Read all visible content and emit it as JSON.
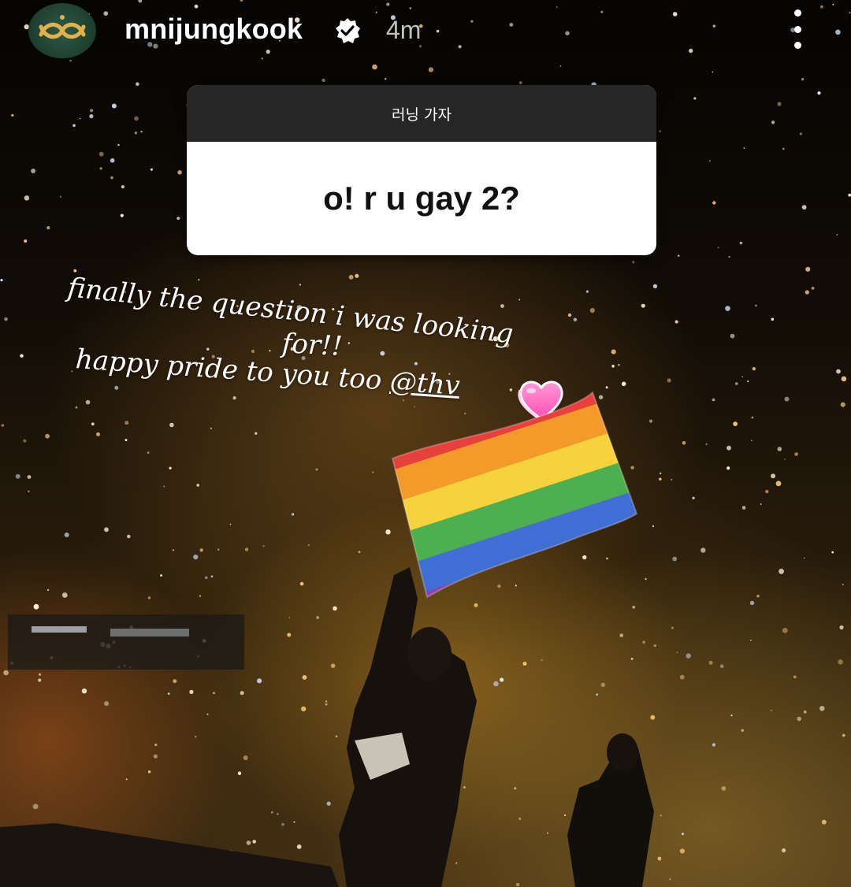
{
  "story": {
    "username": "mnijungkook",
    "timestamp": "4m",
    "verified": true,
    "icons": {
      "avatar": "avatar-logo-icon",
      "verified": "verified-badge-icon",
      "more": "more-options-icon"
    }
  },
  "question_sticker": {
    "prompt": "러닝 가자",
    "answer": "o! r u gay 2?"
  },
  "caption": {
    "line1": "finally the question i was looking",
    "line2": "for!!",
    "line3_prefix": "happy pride to you too ",
    "mention": "@thv"
  },
  "stickers": {
    "heart": "pink-heart-emoji-icon",
    "flag": "rainbow-flag-emoji-icon"
  },
  "colors": {
    "question_header_bg": "#262626",
    "question_body_bg": "#ffffff",
    "text_light": "#ffffff",
    "heart_pink": "#ff5fbd"
  }
}
